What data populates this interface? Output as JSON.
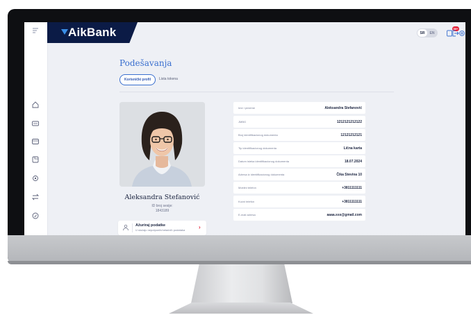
{
  "app": {
    "brand": "AikBank",
    "colors": {
      "brand_navy": "#0b1b46",
      "accent_blue": "#3a6fcf",
      "accent_red": "#e5243b",
      "screen_bg": "#eef0f5"
    }
  },
  "header": {
    "lang_active": "SR",
    "lang_other": "EN",
    "notifications_badge": "99+",
    "icons": [
      "notifications-icon",
      "settings-icon",
      "logout-icon"
    ]
  },
  "sidebar": {
    "icons": [
      "menu-icon",
      "home-icon",
      "card-icon",
      "wallet-icon",
      "payments-icon",
      "exchange-icon",
      "transfer-icon",
      "savings-icon"
    ]
  },
  "page": {
    "title": "Podešavanja",
    "tabs": [
      {
        "label": "Korisnički profil",
        "active": true
      },
      {
        "label": "Lista tokena",
        "active": false
      }
    ]
  },
  "profile": {
    "name": "Aleksandra Stefanović",
    "id_label": "ID broj sesije:",
    "id_value": "1843189",
    "update_card": {
      "title": "Ažuriraj podatke",
      "subtitle": "U slučaju nepotpunih/netačnih podataka"
    }
  },
  "details": [
    {
      "label": "Ime i prezime",
      "value": "Aleksandra Stefanović"
    },
    {
      "label": "JMBG",
      "value": "1212121212122"
    },
    {
      "label": "Broj identifikacionog dokumenta",
      "value": "12121212121"
    },
    {
      "label": "Tip identifikacionog dokumenta",
      "value": "Lična karta"
    },
    {
      "label": "Datum isteka identifikacionog dokumenta",
      "value": "18.07.2024"
    },
    {
      "label": "Adresa iz identifikacionog dokumenta",
      "value": "Čika Stevina 10"
    },
    {
      "label": "Mobilni telefon",
      "value": "+3811111111"
    },
    {
      "label": "Kućni telefon",
      "value": "+3811111111"
    },
    {
      "label": "E-mail adresa",
      "value": "aaaa.sss@gmail.com"
    }
  ]
}
